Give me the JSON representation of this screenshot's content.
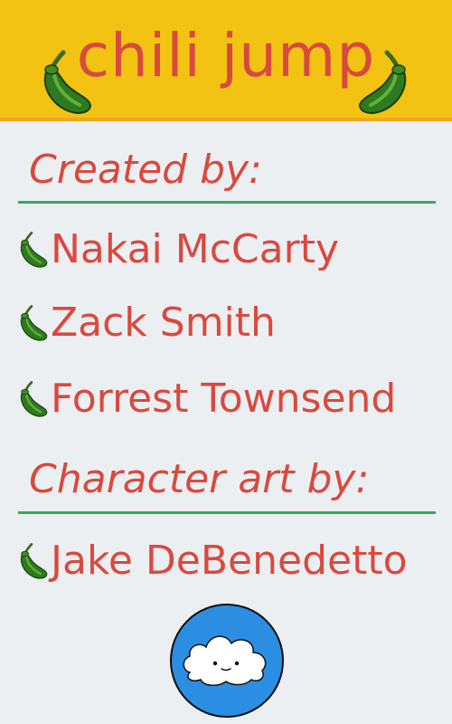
{
  "header": {
    "title": "chili jump",
    "background": "#f2c313",
    "title_color": "#d9493f",
    "left_icon": "jalapeno-pepper-icon",
    "right_icon": "jalapeno-pepper-icon"
  },
  "credits": {
    "created_heading": "Created by:",
    "creators": [
      {
        "name": "Nakai McCarty",
        "icon": "jalapeno-pepper-icon"
      },
      {
        "name": "Zack Smith",
        "icon": "jalapeno-pepper-icon"
      },
      {
        "name": "Forrest Townsend",
        "icon": "jalapeno-pepper-icon"
      }
    ],
    "art_heading": "Character art by:",
    "artists": [
      {
        "name": "Jake DeBenedetto",
        "icon": "jalapeno-pepper-icon"
      }
    ]
  },
  "avatar": {
    "icon": "cloud-character-icon",
    "background": "#2b8ee3"
  },
  "colors": {
    "text": "#d9493f",
    "divider": "#35a963",
    "page_background": "#eceff1",
    "header_border": "#f0a81a"
  }
}
